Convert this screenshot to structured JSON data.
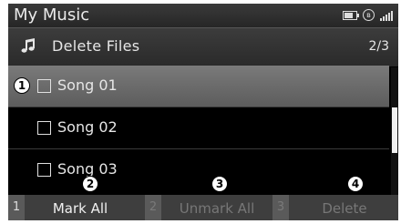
{
  "titlebar": {
    "title": "My Music"
  },
  "header": {
    "title": "Delete Files",
    "page_indicator": "2/3"
  },
  "list": {
    "items": [
      {
        "label": "Song 01",
        "selected": true,
        "checked": false
      },
      {
        "label": "Song 02",
        "selected": false,
        "checked": false
      },
      {
        "label": "Song 03",
        "selected": false,
        "checked": false
      }
    ]
  },
  "softkeys": [
    {
      "number": "1",
      "label": "Mark All",
      "enabled": true
    },
    {
      "number": "2",
      "label": "Unmark All",
      "enabled": false
    },
    {
      "number": "3",
      "label": "Delete",
      "enabled": false
    }
  ],
  "callouts": [
    "1",
    "2",
    "3",
    "4"
  ],
  "status_icons": [
    "battery-icon",
    "bluetooth-icon",
    "signal-icon"
  ],
  "colors": {
    "background": "#000000",
    "selected_row": "#6a6a6a",
    "softkey_bar": "#3e3e3e",
    "text": "#e6e6e6",
    "disabled_text": "#777777"
  }
}
